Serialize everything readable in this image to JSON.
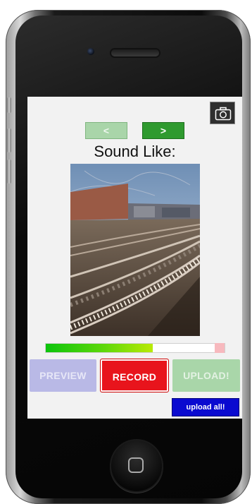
{
  "app": {
    "camera_icon": "camera-icon",
    "nav": {
      "prev_label": "<",
      "next_label": ">"
    },
    "prompt": "Sound Like:",
    "photo": {
      "subject": "railway tracks photo"
    },
    "level_meter": {
      "level": 0.6,
      "fill_color": "#0cc40c"
    },
    "buttons": {
      "preview": "PREVIEW",
      "record": "RECORD",
      "upload": "UPLOAD!",
      "upload_all": "upload all!"
    },
    "colors": {
      "record": "#e8141c",
      "preview_disabled": "#b9b9e6",
      "upload_disabled": "#a9d6a9",
      "upload_all": "#0a0ad0",
      "next": "#2f9a2f"
    }
  }
}
